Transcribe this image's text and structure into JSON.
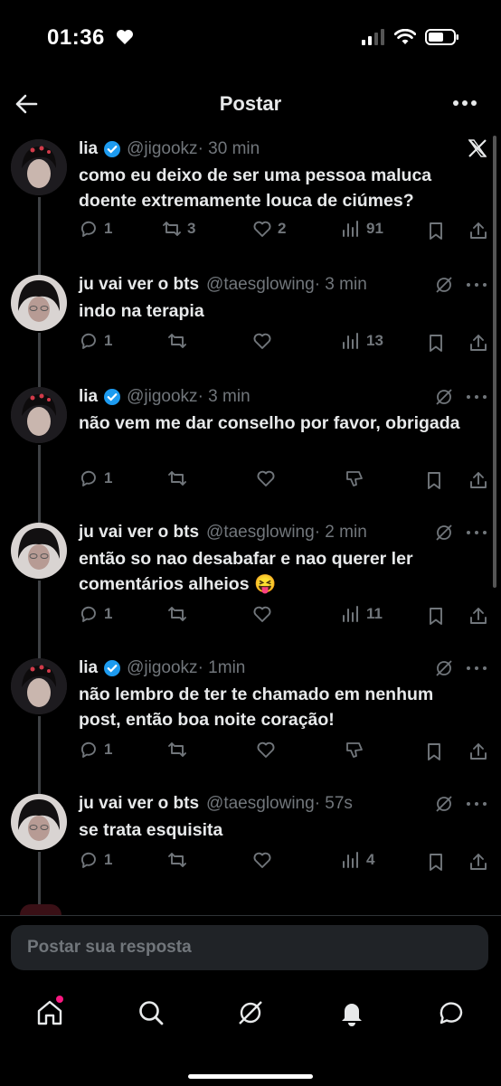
{
  "status_bar": {
    "time": "01:36"
  },
  "nav": {
    "title": "Postar"
  },
  "tweets": [
    {
      "name": "lia",
      "verified": true,
      "handle": "@jigookz",
      "time": "· 30 min",
      "text": "como eu deixo de ser uma pessoa maluca doente extremamente louca de ciúmes?",
      "replies": "1",
      "reposts": "3",
      "likes": "2",
      "views": "91"
    },
    {
      "name": "ju vai ver o bts",
      "verified": false,
      "handle": "@taesglowing",
      "time": "· 3 min",
      "text": "indo na terapia",
      "replies": "1",
      "reposts": "",
      "likes": "",
      "views": "13"
    },
    {
      "name": "lia",
      "verified": true,
      "handle": "@jigookz",
      "time": "· 3 min",
      "text": "não vem me dar conselho por favor, obrigada",
      "replies": "1",
      "reposts": "",
      "likes": ""
    },
    {
      "name": "ju vai ver o bts",
      "verified": false,
      "handle": "@taesglowing",
      "time": "· 2 min",
      "text": "então so nao desabafar e nao querer ler comentários alheios 😝",
      "replies": "1",
      "reposts": "",
      "likes": "",
      "views": "11"
    },
    {
      "name": "lia",
      "verified": true,
      "handle": "@jigookz",
      "time": "· 1min",
      "text": "não lembro de ter te chamado em nenhum post, então boa noite coração!",
      "replies": "1",
      "reposts": "",
      "likes": ""
    },
    {
      "name": "ju vai ver o bts",
      "verified": false,
      "handle": "@taesglowing",
      "time": "· 57s",
      "text": "se trata esquisita",
      "replies": "1",
      "reposts": "",
      "likes": "",
      "views": "4"
    }
  ],
  "composer": {
    "placeholder": "Postar sua resposta"
  },
  "colors": {
    "background": "#000000",
    "text": "#e7e9ea",
    "muted": "#71767b",
    "verified": "#1d9bf0",
    "notification_dot": "#f91880"
  },
  "icons": [
    "back-arrow-icon",
    "more-icon",
    "x-logo-icon",
    "reply-icon",
    "repost-icon",
    "like-icon",
    "views-icon",
    "dislike-icon",
    "bookmark-icon",
    "share-icon",
    "grok-icon",
    "home-icon",
    "search-icon",
    "notifications-icon",
    "messages-icon"
  ]
}
